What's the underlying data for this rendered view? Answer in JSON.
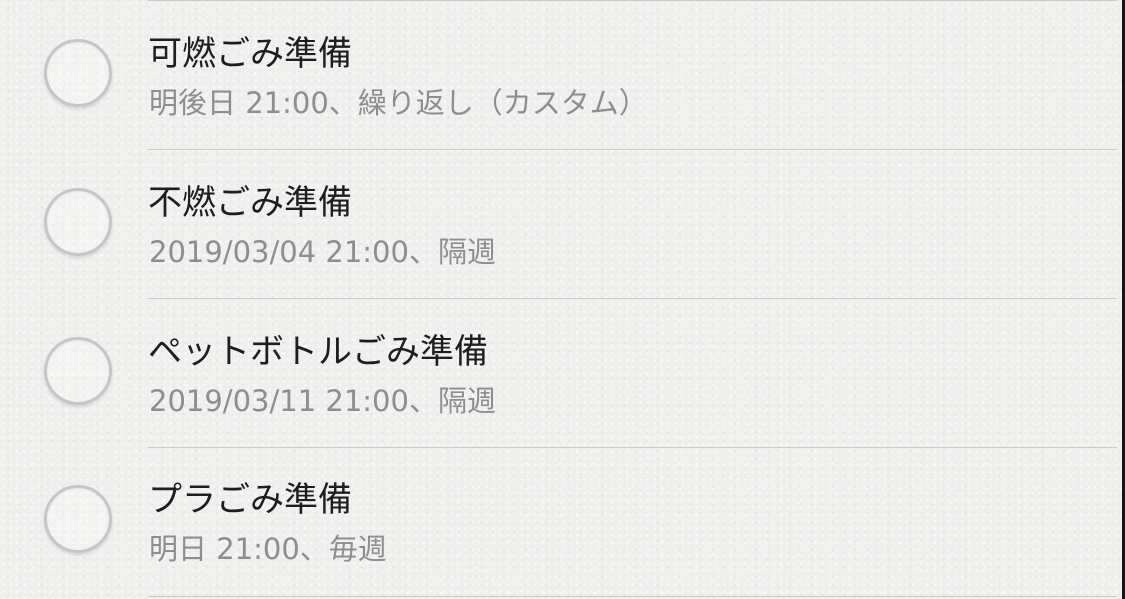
{
  "reminders": [
    {
      "title": "可燃ごみ準備",
      "detail": "明後日 21:00、繰り返し（カスタム）"
    },
    {
      "title": "不燃ごみ準備",
      "detail": "2019/03/04 21:00、隔週"
    },
    {
      "title": "ペットボトルごみ準備",
      "detail": "2019/03/11 21:00、隔週"
    },
    {
      "title": "プラごみ準備",
      "detail": "明日 21:00、毎週"
    }
  ]
}
